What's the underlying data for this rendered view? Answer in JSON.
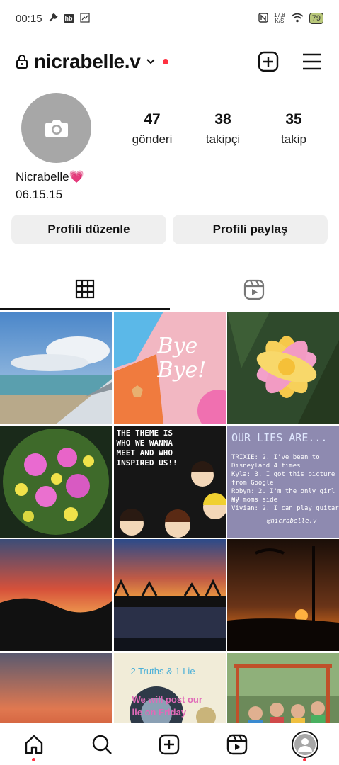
{
  "status": {
    "time": "00:15",
    "hb": "hb",
    "speed_top": "17,8",
    "speed_bottom": "K/S",
    "battery": "79"
  },
  "header": {
    "username": "nicrabelle.v"
  },
  "profile": {
    "posts_count": "47",
    "posts_label": "gönderi",
    "followers_count": "38",
    "followers_label": "takipçi",
    "following_count": "35",
    "following_label": "takip",
    "name": "Nicrabelle💗",
    "bio": "06.15.15"
  },
  "buttons": {
    "edit": "Profili düzenle",
    "share": "Profili paylaş"
  },
  "posts": [
    {
      "kind": "photo",
      "desc": "beach-airplane-wing"
    },
    {
      "kind": "graphic",
      "text": "Bye Bye!"
    },
    {
      "kind": "photo",
      "desc": "plumeria-flower"
    },
    {
      "kind": "photo",
      "desc": "fisheye-flowers"
    },
    {
      "kind": "graphic",
      "text": "THE THEME IS WHO WE WANNA MEET AND WHO INSPIRED US!!"
    },
    {
      "kind": "graphic",
      "title": "OUR LIES ARE...",
      "lines": [
        "TRIXIE: 2. I've been to",
        "Disneyland 4 times",
        "Kyla: 3. I got this picture",
        "from Google",
        "Robyn: 2. I'm the only girl on",
        "my moms side",
        "Vivian: 2. I can play guitar"
      ],
      "credit": "@nicrabelle.v"
    },
    {
      "kind": "photo",
      "desc": "sunset-hills"
    },
    {
      "kind": "photo",
      "desc": "sunset-palms-beach"
    },
    {
      "kind": "photo",
      "desc": "sunset-pole"
    },
    {
      "kind": "photo",
      "desc": "sunset-sky"
    },
    {
      "kind": "graphic",
      "lines": [
        "2 Truths & 1 Lie",
        "We will post our",
        "lie on Friday"
      ]
    },
    {
      "kind": "photo",
      "desc": "kids-playground"
    }
  ],
  "colors": {
    "accent_red": "#ff3040",
    "button_bg": "#efefef",
    "avatar_bg": "#a7a7a7"
  }
}
